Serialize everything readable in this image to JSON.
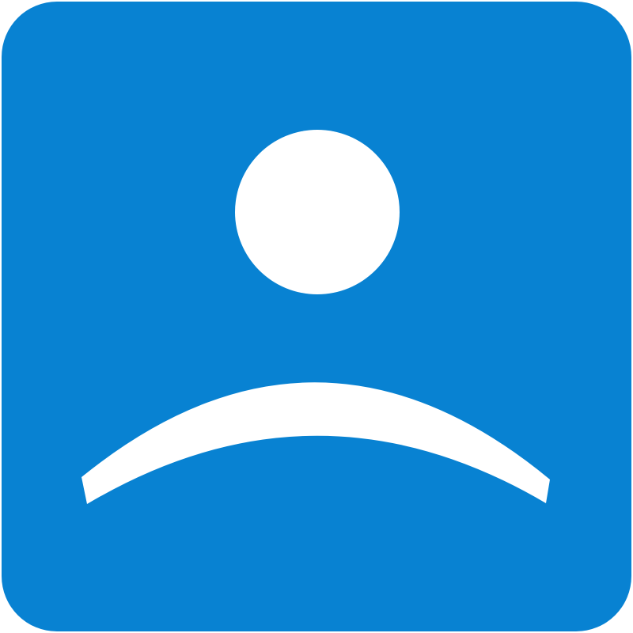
{
  "icon": {
    "name": "user-avatar-icon",
    "colors": {
      "background": "#0882D2",
      "figure": "#FFFFFF"
    }
  }
}
